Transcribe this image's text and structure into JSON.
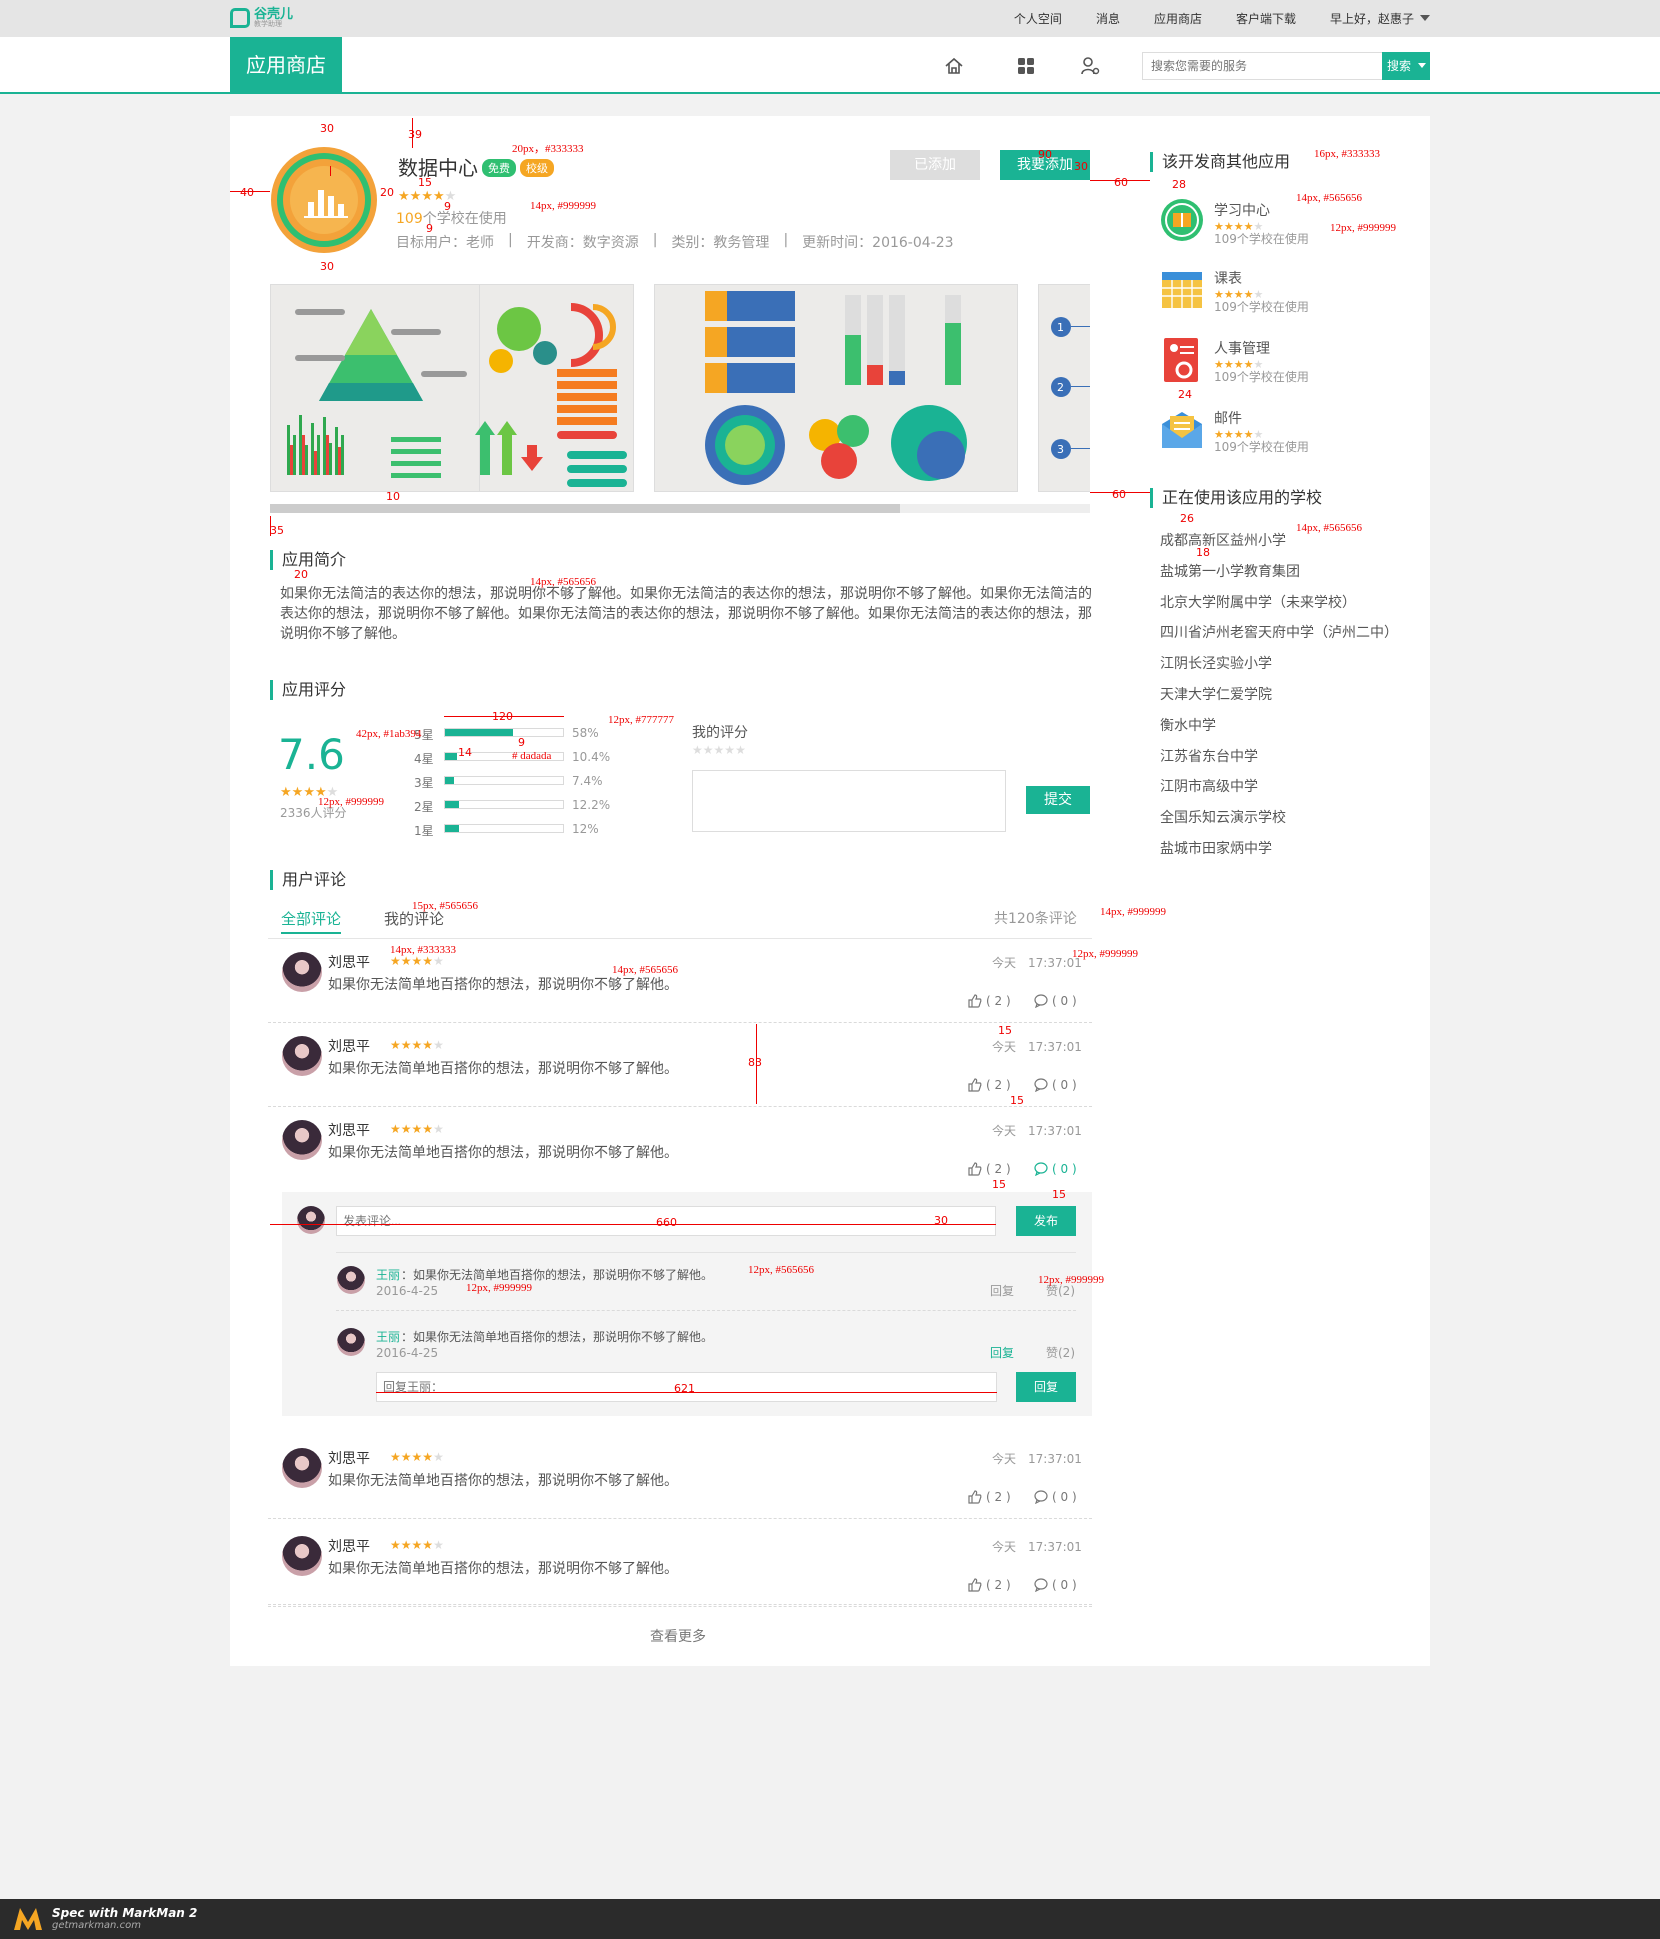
{
  "topnav": {
    "logo_name": "谷壳儿",
    "logo_sub": "教学助理",
    "items": [
      "个人空间",
      "消息",
      "应用商店",
      "客户端下载"
    ],
    "greeting": "早上好，赵惠子"
  },
  "header": {
    "brand": "应用商店",
    "search_placeholder": "搜索您需要的服务",
    "search_btn": "搜索"
  },
  "app": {
    "name": "数据中心",
    "badge_free": "免费",
    "badge_school": "校级",
    "usage_count": "109",
    "usage_suffix": "个学校在使用",
    "target": "目标用户：老师",
    "developer": "开发商：数字资源",
    "category": "类别：教务管理",
    "updated": "更新时间：2016-04-23",
    "btn_added": "已添加",
    "btn_add": "我要添加",
    "rating_stars": 4
  },
  "intro": {
    "title": "应用简介",
    "text": "如果你无法简洁的表达你的想法，那说明你不够了解他。如果你无法简洁的表达你的想法，那说明你不够了解他。如果你无法简洁的表达你的想法，那说明你不够了解他。如果你无法简洁的表达你的想法，那说明你不够了解他。如果你无法简洁的表达你的想法，那说明你不够了解他。"
  },
  "rating": {
    "title": "应用评分",
    "score": "7.6",
    "count_text": "2336人评分",
    "levels": [
      {
        "label": "5星",
        "pct_text": "58%",
        "pct": 58
      },
      {
        "label": "4星",
        "pct_text": "10.4%",
        "pct": 10.4
      },
      {
        "label": "3星",
        "pct_text": "7.4%",
        "pct": 7.4
      },
      {
        "label": "2星",
        "pct_text": "12.2%",
        "pct": 12.2
      },
      {
        "label": "1星",
        "pct_text": "12%",
        "pct": 12
      }
    ],
    "my_rating": "我的评分",
    "submit": "提交"
  },
  "comments": {
    "title": "用户评论",
    "tab_all": "全部评论",
    "tab_mine": "我的评论",
    "total": "共120条评论",
    "reply_placeholder_main": "发表评论...",
    "publish": "发布",
    "reply_placeholder": "回复王丽：",
    "reply_btn": "回复",
    "more": "查看更多",
    "items": [
      {
        "user": "刘思平",
        "text": "如果你无法简单地百搭你的想法，那说明你不够了解他。",
        "time": "今天　17:37:01",
        "likes": "( 2 )",
        "replies": "( 0 )"
      },
      {
        "user": "刘思平",
        "text": "如果你无法简单地百搭你的想法，那说明你不够了解他。",
        "time": "今天　17:37:01",
        "likes": "( 2 )",
        "replies": "( 0 )"
      },
      {
        "user": "刘思平",
        "text": "如果你无法简单地百搭你的想法，那说明你不够了解他。",
        "time": "今天　17:37:01",
        "likes": "( 2 )",
        "replies": "( 0 )"
      },
      {
        "user": "刘思平",
        "text": "如果你无法简单地百搭你的想法，那说明你不够了解他。",
        "time": "今天　17:37:01",
        "likes": "( 2 )",
        "replies": "( 0 )"
      },
      {
        "user": "刘思平",
        "text": "如果你无法简单地百搭你的想法，那说明你不够了解他。",
        "time": "今天　17:37:01",
        "likes": "( 2 )",
        "replies": "( 0 )"
      }
    ],
    "subreplies": [
      {
        "user": "王丽",
        "text": "：如果你无法简单地百搭你的想法，那说明你不够了解他。",
        "date": "2016-4-25",
        "reply": "回复",
        "like": "赞(2)"
      },
      {
        "user": "王丽",
        "text": "：如果你无法简单地百搭你的想法，那说明你不够了解他。",
        "date": "2016-4-25",
        "reply": "回复",
        "like": "赞(2)"
      }
    ]
  },
  "sidebar": {
    "other_title": "该开发商其他应用",
    "apps": [
      {
        "name": "学习中心",
        "usage": "109个学校在使用"
      },
      {
        "name": "课表",
        "usage": "109个学校在使用"
      },
      {
        "name": "人事管理",
        "usage": "109个学校在使用"
      },
      {
        "name": "邮件",
        "usage": "109个学校在使用"
      }
    ],
    "schools_title": "正在使用该应用的学校",
    "schools": [
      "成都高新区益州小学",
      "盐城第一小学教育集团",
      "北京大学附属中学（未来学校）",
      "四川省泸州老窖天府中学（泸州二中）",
      "江阴长泾实验小学",
      "天津大学仁爱学院",
      "衡水中学",
      "江苏省东台中学",
      "江阴市高级中学",
      "全国乐知云演示学校",
      "盐城市田家炳中学"
    ]
  },
  "annotations": [
    "20px，#333333",
    "14px, #999999",
    "16px, #333333",
    "14px, #565656",
    "12px, #999999",
    "14px, #565656",
    "14px, #565656",
    "42px, #1ab394",
    "12px, #777777",
    "# dadada",
    "12px, #999999",
    "15px, #565656",
    "14px, #999999",
    "14px, #333333",
    "14px, #565656",
    "12px, #999999",
    "12px, #565656",
    "12px, #999999",
    "12px, #999999"
  ],
  "measures": [
    "30",
    "39",
    "40",
    "20",
    "15",
    "9",
    "9",
    "30",
    "90",
    "30",
    "60",
    "28",
    "24",
    "26",
    "18",
    "10",
    "35",
    "20",
    "120",
    "14",
    "9",
    "83",
    "15",
    "15",
    "15",
    "15",
    "660",
    "30",
    "621",
    "60"
  ],
  "footer": {
    "brand": "Spec with MarkMan 2",
    "url": "getmarkman.com"
  },
  "colors": {
    "accent": "#1ab394",
    "star": "#f5a623",
    "red": "#e00000"
  }
}
